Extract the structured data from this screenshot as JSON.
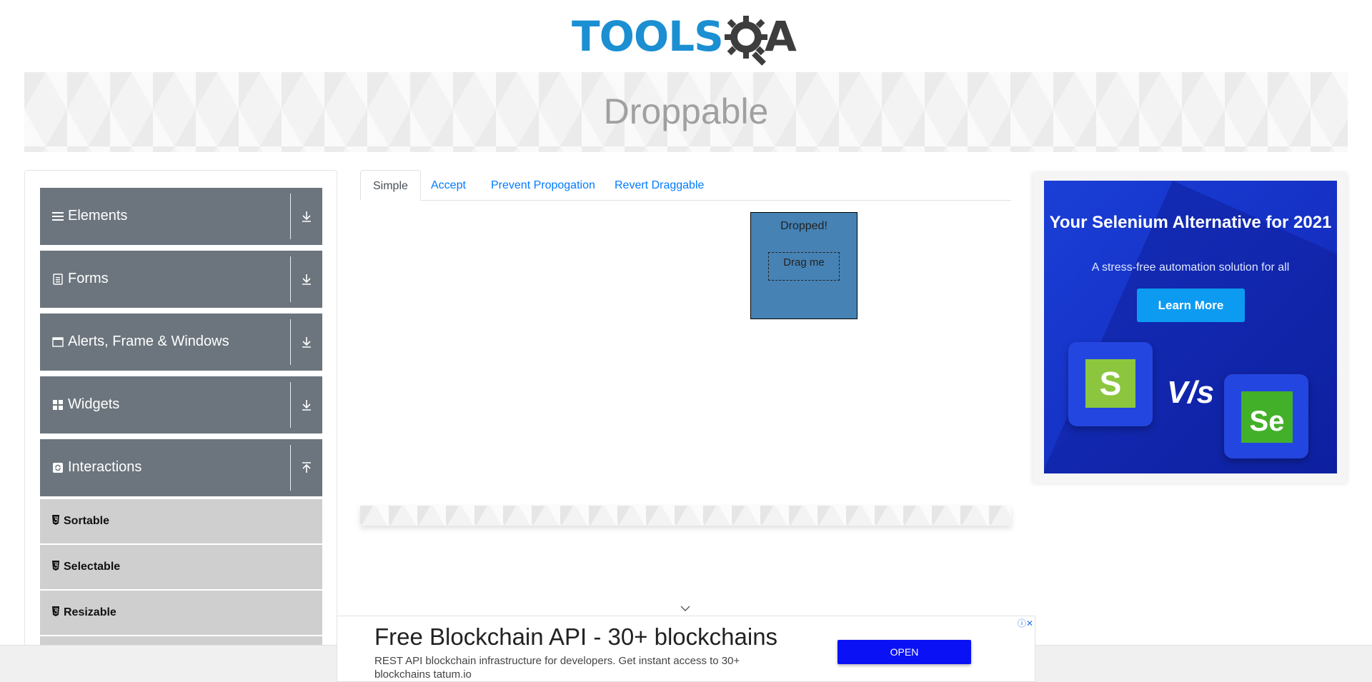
{
  "header": {
    "logo_tools": "TOOLS",
    "logo_qa": "A"
  },
  "banner": {
    "title": "Droppable"
  },
  "sidebar": {
    "groups": [
      {
        "label": "Elements",
        "icon": "list-icon",
        "expanded": false
      },
      {
        "label": "Forms",
        "icon": "form-icon",
        "expanded": false
      },
      {
        "label": "Alerts, Frame & Windows",
        "icon": "window-icon",
        "expanded": false
      },
      {
        "label": "Widgets",
        "icon": "grid-icon",
        "expanded": false
      },
      {
        "label": "Interactions",
        "icon": "interactions-icon",
        "expanded": true
      }
    ],
    "sub_items": [
      {
        "label": "Sortable",
        "icon": "html5-icon"
      },
      {
        "label": "Selectable",
        "icon": "html5-icon"
      },
      {
        "label": "Resizable",
        "icon": "html5-icon"
      }
    ]
  },
  "tabs": [
    {
      "label": "Simple",
      "active": true
    },
    {
      "label": "Accept",
      "active": false
    },
    {
      "label": "Prevent Propogation",
      "active": false
    },
    {
      "label": "Revert Draggable",
      "active": false
    }
  ],
  "droppable": {
    "target_text": "Dropped!",
    "draggable_text": "Drag me",
    "target_color": "#4682b4"
  },
  "side_ad": {
    "headline": "Your Selenium Alternative for 2021",
    "subtext": "A stress-free automation solution for all",
    "button": "Learn More",
    "logo_left": "S",
    "vs": "V/s",
    "logo_right": "Se"
  },
  "bottom_ad": {
    "title": "Free Blockchain API - 30+ blockchains",
    "description": "REST API blockchain infrastructure for developers. Get instant access to 30+ blockchains tatum.io",
    "button": "OPEN",
    "adchoices": "ⓘ✕"
  },
  "colors": {
    "brand_blue": "#1b8fd2",
    "sidebar_group": "#6c757d",
    "sidebar_sub": "#cfcfcf",
    "link": "#007bff",
    "open_button": "#0a12f5"
  }
}
